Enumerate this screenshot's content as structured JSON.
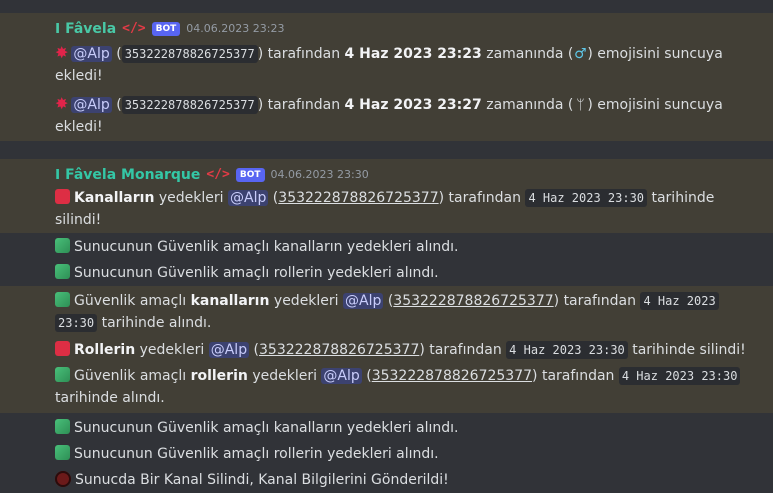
{
  "msg1": {
    "prefix": "ⵏ Fâvela",
    "code_tag": "</>",
    "bot": "BOT",
    "timestamp": "04.06.2023 23:23",
    "lines": [
      {
        "mention": "@Alp",
        "uid": "353222878826725377",
        "t1": ") tarafından",
        "date": "4 Haz 2023 23:23",
        "t2": "zamanında (",
        "emoji": "♂",
        "t3": ") emojisini suncuya",
        "t4": "ekledi!"
      },
      {
        "mention": "@Alp",
        "uid": "353222878826725377",
        "t1": ") tarafından",
        "date": "4 Haz 2023 23:27",
        "t2": "zamanında (",
        "emoji": "ᛘ",
        "t3": ") emojisini suncuya",
        "t4": "ekledi!"
      }
    ]
  },
  "msg2": {
    "prefix": "ⵏ Fâvela Monarque",
    "code_tag": "</>",
    "bot": "BOT",
    "timestamp": "04.06.2023 23:30",
    "line1": {
      "b": "Kanalların",
      "t1": "yedekleri",
      "mention": "@Alp",
      "uid": "353222878826725377",
      "t2": "tarafından",
      "date": "4 Haz 2023 23:30",
      "t3": "tarihinde",
      "t4": "silindi!"
    },
    "line2": "Sunucunun Güvenlik amaçlı kanalların yedekleri alındı.",
    "line3": "Sunucunun Güvenlik amaçlı rollerin yedekleri alındı.",
    "line4": {
      "t1": "Güvenlik amaçlı",
      "b": "kanalların",
      "t2": "yedekleri",
      "mention": "@Alp",
      "uid": "353222878826725377",
      "t3": "tarafından",
      "date1": "4 Haz 2023",
      "date2": "23:30",
      "t4": "tarihinde alındı."
    },
    "line5": {
      "b": "Rollerin",
      "t1": "yedekleri",
      "mention": "@Alp",
      "uid": "353222878826725377",
      "t2": "tarafından",
      "date": "4 Haz 2023 23:30",
      "t3": "tarihinde silindi!"
    },
    "line6": {
      "t1": "Güvenlik amaçlı",
      "b": "rollerin",
      "t2": "yedekleri",
      "mention": "@Alp",
      "uid": "353222878826725377",
      "t3": "tarafından",
      "date": "4 Haz 2023 23:30",
      "t4": "tarihinde alındı."
    },
    "line7": "Sunucunun Güvenlik amaçlı kanalların yedekleri alındı.",
    "line8": "Sunucunun Güvenlik amaçlı rollerin yedekleri alındı.",
    "line9": "Sunucda Bir Kanal Silindi, Kanal Bilgilerini Gönderildi!"
  }
}
